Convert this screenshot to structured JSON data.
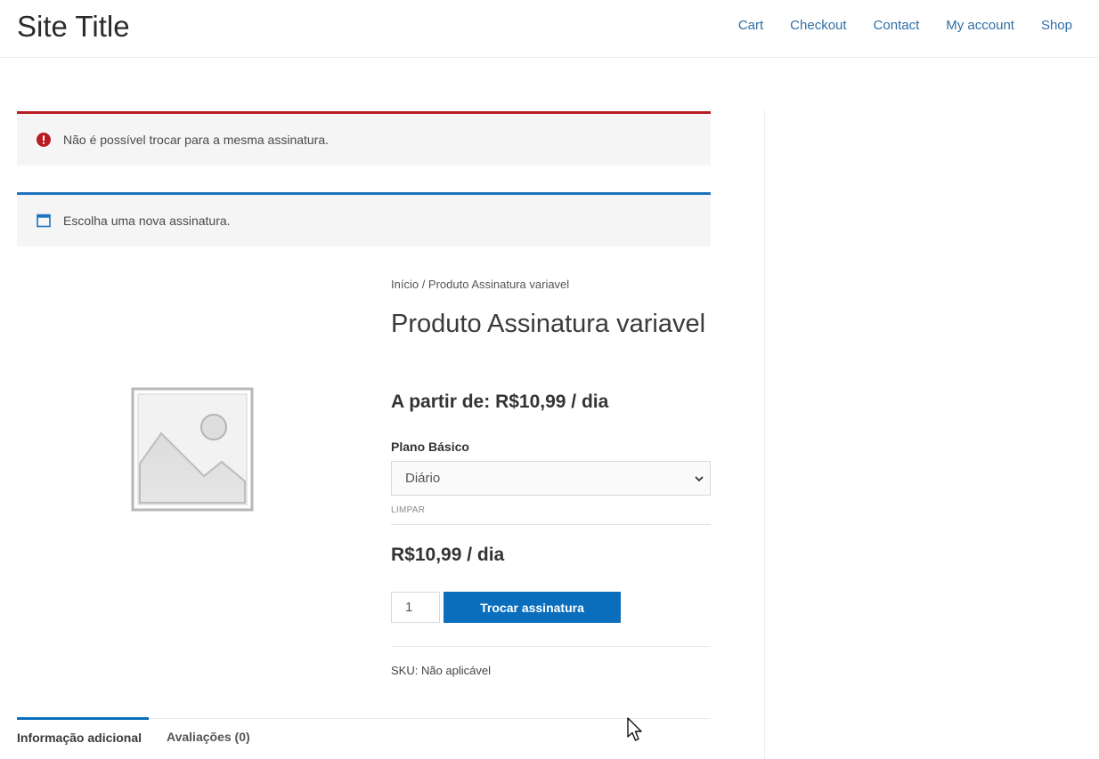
{
  "header": {
    "site_title": "Site Title",
    "nav": [
      {
        "label": "Cart"
      },
      {
        "label": "Checkout"
      },
      {
        "label": "Contact"
      },
      {
        "label": "My account"
      },
      {
        "label": "Shop"
      }
    ]
  },
  "notices": {
    "error": {
      "text": "Não é possível trocar para a mesma assinatura.",
      "icon": "exclamation-circle-icon",
      "color": "#b81c23"
    },
    "info": {
      "text": "Escolha uma nova assinatura.",
      "icon": "window-icon",
      "color": "#1e73be"
    }
  },
  "breadcrumb": {
    "home": "Início",
    "separator": " / ",
    "current": "Produto Assinatura variavel"
  },
  "product": {
    "title": "Produto Assinatura variavel",
    "price_range": "A partir de: R$10,99 / dia",
    "variation_label": "Plano Básico",
    "variation_selected": "Diário",
    "reset_label": "LIMPAR",
    "variation_price": "R$10,99 / dia",
    "quantity": "1",
    "button_label": "Trocar assinatura",
    "button_color": "#0a6ebd",
    "sku_label": "SKU:",
    "sku_value": "Não aplicável",
    "image_icon": "image-placeholder-icon"
  },
  "tabs": [
    {
      "label": "Informação adicional",
      "active": true
    },
    {
      "label": "Avaliações (0)",
      "active": false
    }
  ]
}
